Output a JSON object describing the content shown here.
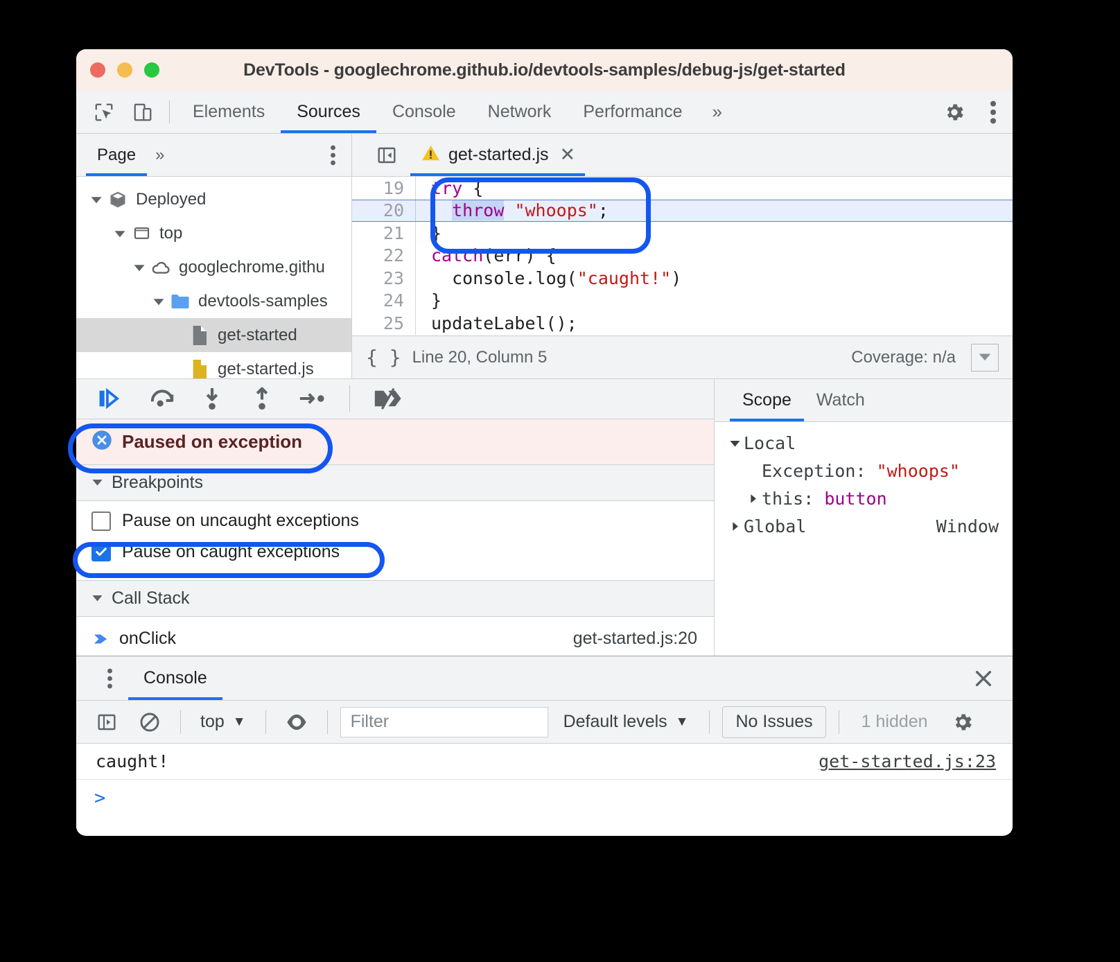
{
  "window": {
    "title": "DevTools - googlechrome.github.io/devtools-samples/debug-js/get-started",
    "traffic": {
      "close": "close",
      "minimize": "minimize",
      "maximize": "maximize"
    }
  },
  "toolbar": {
    "inspect_icon": "inspect-element-icon",
    "device_icon": "device-toolbar-icon",
    "tabs": [
      {
        "label": "Elements",
        "active": false
      },
      {
        "label": "Sources",
        "active": true
      },
      {
        "label": "Console",
        "active": false
      },
      {
        "label": "Network",
        "active": false
      },
      {
        "label": "Performance",
        "active": false
      }
    ],
    "more_tabs": "»",
    "settings_icon": "gear-icon",
    "menu_icon": "kebab-menu-icon"
  },
  "navigator": {
    "tabs": [
      {
        "label": "Page",
        "active": true
      }
    ],
    "more": "»",
    "menu_icon": "kebab-menu-icon",
    "tree": [
      {
        "label": "Deployed",
        "icon": "cube-icon",
        "depth": 0,
        "expanded": true,
        "selected": false
      },
      {
        "label": "top",
        "icon": "frame-icon",
        "depth": 1,
        "expanded": true,
        "selected": false
      },
      {
        "label": "googlechrome.githu",
        "icon": "cloud-icon",
        "depth": 2,
        "expanded": true,
        "selected": false
      },
      {
        "label": "devtools-samples",
        "icon": "folder-icon",
        "depth": 3,
        "expanded": true,
        "selected": false
      },
      {
        "label": "get-started",
        "icon": "document-icon",
        "depth": 4,
        "expanded": null,
        "selected": true
      },
      {
        "label": "get-started.js",
        "icon": "js-document-icon",
        "depth": 4,
        "expanded": null,
        "selected": false
      }
    ]
  },
  "editor": {
    "sidebar_toggle_icon": "show-navigator-icon",
    "warning_icon": "warning-triangle-icon",
    "tab_label": "get-started.js",
    "close_icon": "close-icon",
    "lines": [
      {
        "num": "19",
        "highlight": false,
        "tokens": [
          {
            "t": "try",
            "c": "kw"
          },
          {
            "t": " {",
            "c": "plain"
          }
        ]
      },
      {
        "num": "20",
        "highlight": true,
        "tokens": [
          {
            "t": "  ",
            "c": "plain"
          },
          {
            "t": "throw",
            "c": "kw sel-tok"
          },
          {
            "t": " ",
            "c": "plain"
          },
          {
            "t": "\"whoops\"",
            "c": "str"
          },
          {
            "t": ";",
            "c": "plain"
          }
        ]
      },
      {
        "num": "21",
        "highlight": false,
        "tokens": [
          {
            "t": "}",
            "c": "plain"
          }
        ]
      },
      {
        "num": "22",
        "highlight": false,
        "tokens": [
          {
            "t": "catch",
            "c": "kw"
          },
          {
            "t": "(err) {",
            "c": "plain"
          }
        ]
      },
      {
        "num": "23",
        "highlight": false,
        "tokens": [
          {
            "t": "  console.log(",
            "c": "plain"
          },
          {
            "t": "\"caught!\"",
            "c": "str"
          },
          {
            "t": ")",
            "c": "plain"
          }
        ]
      },
      {
        "num": "24",
        "highlight": false,
        "tokens": [
          {
            "t": "}",
            "c": "plain"
          }
        ]
      },
      {
        "num": "25",
        "highlight": false,
        "tokens": [
          {
            "t": "updateLabel();",
            "c": "plain"
          }
        ]
      }
    ],
    "status": {
      "format_icon": "pretty-print-braces-icon",
      "position": "Line 20, Column 5",
      "coverage": "Coverage: n/a",
      "drawer_icon": "show-drawer-icon"
    }
  },
  "debugger": {
    "buttons": [
      {
        "name": "resume-script-execution",
        "icon": "resume-icon"
      },
      {
        "name": "step-over-next-call",
        "icon": "step-over-icon"
      },
      {
        "name": "step-into-next-call",
        "icon": "step-into-icon"
      },
      {
        "name": "step-out-of-current-function",
        "icon": "step-out-icon"
      },
      {
        "name": "step",
        "icon": "step-icon"
      },
      {
        "name": "deactivate-breakpoints",
        "icon": "deactivate-breakpoints-icon"
      }
    ],
    "paused_banner": {
      "icon": "exception-circle-icon",
      "text": "Paused on exception"
    },
    "breakpoints": {
      "title": "Breakpoints",
      "expanded": true,
      "items": [
        {
          "label": "Pause on uncaught exceptions",
          "checked": false
        },
        {
          "label": "Pause on caught exceptions",
          "checked": true
        }
      ]
    },
    "callstack": {
      "title": "Call Stack",
      "expanded": true,
      "frames": [
        {
          "icon": "current-frame-arrow-icon",
          "name": "onClick",
          "location": "get-started.js:20"
        }
      ]
    }
  },
  "scope": {
    "tabs": [
      {
        "label": "Scope",
        "active": true
      },
      {
        "label": "Watch",
        "active": false
      }
    ],
    "rows": [
      {
        "caret": "expanded",
        "indent": 0,
        "name": "Local",
        "sep": "",
        "value": "",
        "value_class": "",
        "right": ""
      },
      {
        "caret": "none",
        "indent": 1,
        "name": "Exception",
        "sep": ": ",
        "value": "\"whoops\"",
        "value_class": "val-str",
        "right": ""
      },
      {
        "caret": "collapsed",
        "indent": 0,
        "name": "this",
        "sep": ": ",
        "value": "button",
        "value_class": "val-obj",
        "right": ""
      },
      {
        "caret": "collapsed",
        "indent": 0,
        "name": "Global",
        "sep": "",
        "value": "",
        "value_class": "",
        "right": "Window"
      }
    ]
  },
  "drawer": {
    "menu_icon": "kebab-menu-icon",
    "tabs": [
      {
        "label": "Console",
        "active": true
      }
    ],
    "close_icon": "close-icon",
    "toolbar": {
      "sidebar_icon": "show-console-sidebar-icon",
      "clear_icon": "clear-console-icon",
      "context_label": "top",
      "context_caret": "▼",
      "eye_icon": "live-expression-eye-icon",
      "filter_placeholder": "Filter",
      "filter_value": "",
      "levels_label": "Default levels",
      "levels_caret": "▼",
      "issues_label": "No Issues",
      "hidden_label": "1 hidden",
      "settings_icon": "gear-icon"
    },
    "messages": [
      {
        "text": "caught!",
        "link": "get-started.js:23"
      }
    ],
    "prompt": ">"
  },
  "annotations": {
    "accent_color": "#1456f0",
    "boxes": [
      {
        "name": "code-highlight-box",
        "target": "throw statement lines 19-21"
      },
      {
        "name": "paused-banner-box",
        "target": "Paused on exception"
      },
      {
        "name": "caught-exceptions-checkbox-box",
        "target": "Pause on caught exceptions"
      }
    ]
  }
}
